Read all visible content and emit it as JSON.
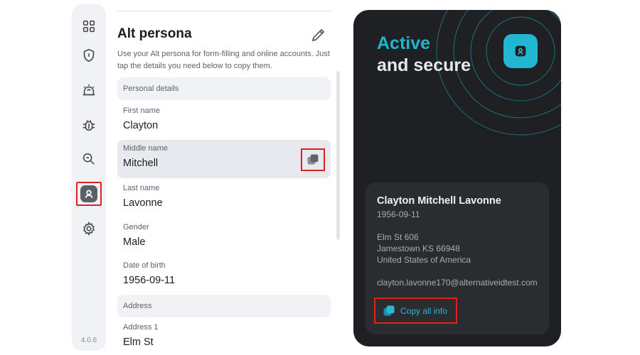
{
  "app": {
    "version": "4.0.6"
  },
  "nav": [
    {
      "name": "dashboard",
      "icon": "grid-icon"
    },
    {
      "name": "privacy",
      "icon": "shield-icon"
    },
    {
      "name": "alerts",
      "icon": "alarm-icon"
    },
    {
      "name": "threats",
      "icon": "bug-icon"
    },
    {
      "name": "identity-scan",
      "icon": "magnifier-icon"
    },
    {
      "name": "alt-persona",
      "icon": "persona-icon",
      "active": true
    },
    {
      "name": "settings",
      "icon": "gear-icon"
    }
  ],
  "panel": {
    "title": "Alt persona",
    "description": "Use your Alt persona for form-filling and online accounts. Just tap the details you need below to copy them.",
    "edit_icon": "pencil-icon",
    "sections": {
      "personal": "Personal details",
      "address": "Address"
    },
    "fields": [
      {
        "label": "First name",
        "value": "Clayton"
      },
      {
        "label": "Middle name",
        "value": "Mitchell",
        "selected": true
      },
      {
        "label": "Last name",
        "value": "Lavonne"
      },
      {
        "label": "Gender",
        "value": "Male"
      },
      {
        "label": "Date of birth",
        "value": "1956-09-11"
      },
      {
        "label": "Address 1",
        "value": "Elm St"
      }
    ]
  },
  "card": {
    "heading_accent": "Active",
    "heading_rest": "and secure",
    "badge_icon": "persona-icon",
    "full_name": "Clayton Mitchell Lavonne",
    "dob": "1956-09-11",
    "address_lines": [
      "Elm St 606",
      "Jamestown KS 66948",
      "United States of America"
    ],
    "email": "clayton.lavonne170@alternativeidtest.com",
    "copy_all_label": "Copy all info"
  },
  "colors": {
    "accent": "#21b6d2",
    "highlight": "#e0211f",
    "card_bg": "#1f2023"
  }
}
